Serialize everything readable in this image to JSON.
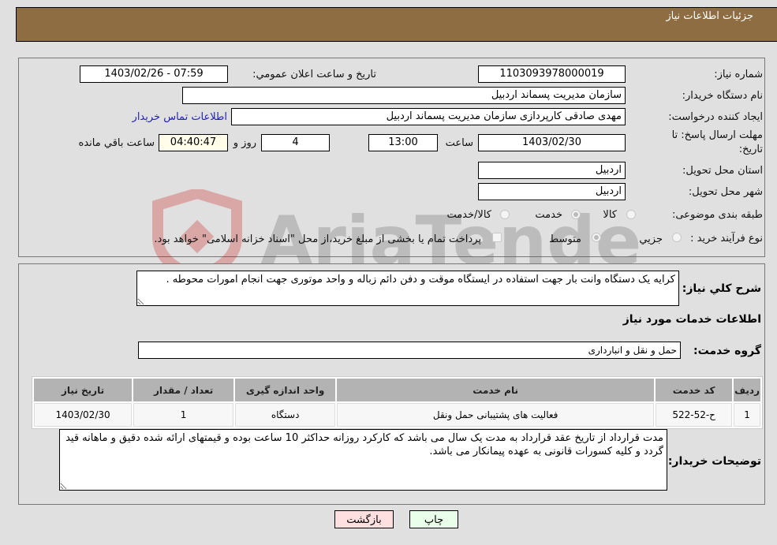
{
  "header": {
    "title": "جزئیات اطلاعات نیاز"
  },
  "fields": {
    "need_number": {
      "label": "شماره نیاز:",
      "value": "1103093978000019"
    },
    "announce_datetime": {
      "label": "تاريخ و ساعت اعلان عمومي:",
      "value": "1403/02/26 - 07:59"
    },
    "buyer_org": {
      "label": "نام دستگاه خریدار:",
      "value": "سازمان مدیریت پسماند اردبیل"
    },
    "requester": {
      "label": "ایجاد کننده درخواست:",
      "value": "مهدی صادقی کارپردازی سازمان مدیریت پسماند اردبیل",
      "contact_link": "اطلاعات تماس خریدار"
    },
    "deadline": {
      "label_line1": "مهلت ارسال پاسخ: تا",
      "label_line2": "تاریخ:",
      "date": "1403/02/30",
      "time_label": "ساعت",
      "time": "13:00",
      "days": "4",
      "days_label": "روز و",
      "remaining": "04:40:47",
      "remaining_label": "ساعت باقي مانده"
    },
    "province": {
      "label": "استان محل تحویل:",
      "value": "اردبیل"
    },
    "city": {
      "label": "شهر محل تحویل:",
      "value": "اردبیل"
    },
    "category": {
      "label": "طبقه بندی موضوعی:",
      "options": [
        {
          "label": "کالا",
          "checked": false
        },
        {
          "label": "خدمت",
          "checked": true
        },
        {
          "label": "کالا/خدمت",
          "checked": false
        }
      ]
    },
    "process_type": {
      "label": "نوع فرآیند خرید :",
      "options": [
        {
          "label": "جزيي",
          "checked": false
        },
        {
          "label": "متوسط",
          "checked": true
        }
      ],
      "treasury_note": "پرداخت تمام یا بخشی از مبلغ خرید،از محل \"اسناد خزانه اسلامی\" خواهد بود."
    }
  },
  "description": {
    "label": "شرح کلي نياز:",
    "value": "کرایه یک دستگاه وانت بار جهت استفاده در ایستگاه موقت و دفن دائم زباله و واحد موتوری جهت انجام امورات محوطه ."
  },
  "services_section": {
    "title": "اطلاعات خدمات مورد نیاز",
    "group_label": "گروه خدمت:",
    "group_value": "حمل و نقل و انبارداری"
  },
  "table": {
    "headers": [
      "ردیف",
      "کد خدمت",
      "نام خدمت",
      "واحد اندازه گیری",
      "تعداد / مقدار",
      "تاریخ نیاز"
    ],
    "rows": [
      [
        "1",
        "ح-52-522",
        "فعالیت های پشتیبانی حمل ونقل",
        "دستگاه",
        "1",
        "1403/02/30"
      ]
    ]
  },
  "buyer_notes": {
    "label": "توضیحات خریدار:",
    "value": "مدت قرارداد از تاریخ عقد قرارداد به مدت یک سال می باشد که کارکرد روزانه حداکثر 10 ساعت بوده و قیمتهای ارائه شده دقیق و ماهانه قید گردد و کلیه کسورات قانونی به عهده پیمانکار می باشد."
  },
  "buttons": {
    "print": "چاپ",
    "back": "بازگشت"
  },
  "colors": {
    "header": "#8e6d42",
    "print_bg": "#eaffea",
    "back_bg": "#ffe0e0",
    "link": "#2020c0"
  },
  "watermark": {
    "text": "AriaTender.neT"
  }
}
